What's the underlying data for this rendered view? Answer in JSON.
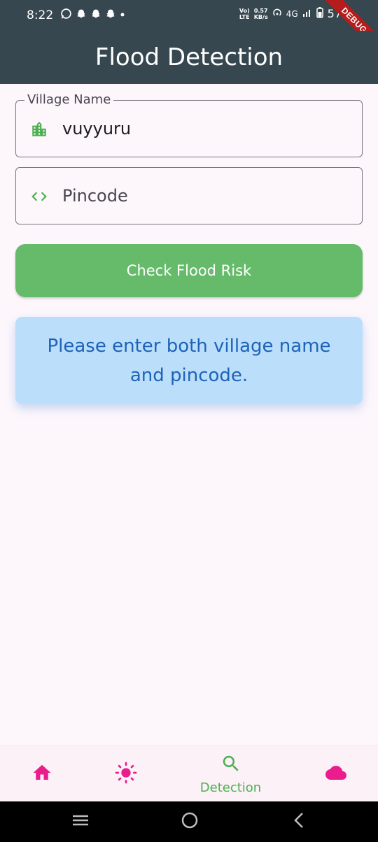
{
  "status_bar": {
    "time": "8:22",
    "net_line1": "Vo)",
    "net_line2": "LTE",
    "speed_value": "0.57",
    "speed_unit": "KB/s",
    "network": "4G",
    "battery": "57"
  },
  "debug_banner": "DEBUG",
  "app_bar": {
    "title": "Flood Detection"
  },
  "form": {
    "village": {
      "label": "Village Name",
      "value": "vuyyuru"
    },
    "pincode": {
      "placeholder": "Pincode",
      "value": ""
    },
    "submit_label": "Check Flood Risk"
  },
  "message": {
    "text": "Please enter both village name and pincode."
  },
  "bottom_nav": {
    "items": [
      {
        "icon": "home-icon",
        "label": ""
      },
      {
        "icon": "sun-icon",
        "label": ""
      },
      {
        "icon": "search-icon",
        "label": "Detection"
      },
      {
        "icon": "cloud-icon",
        "label": ""
      }
    ],
    "selected_index": 2
  },
  "colors": {
    "app_bar": "#37474f",
    "accent_green": "#66bb6a",
    "nav_pink": "#e91e8c",
    "message_bg": "#bbdefb",
    "message_text": "#1e63b7"
  }
}
